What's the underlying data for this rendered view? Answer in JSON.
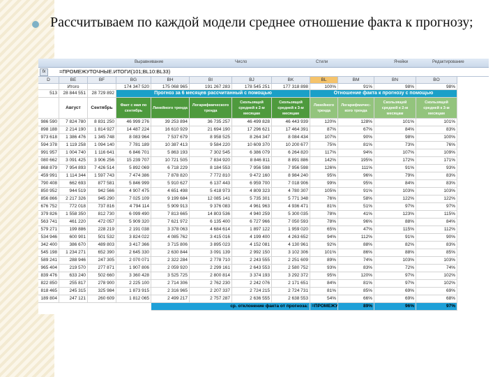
{
  "heading": "Рассчитываем по каждой модели среднее отношение факта к прогнозу;",
  "ribbon": {
    "groups": [
      "Выравнивание",
      "Число",
      "Стили",
      "Ячейки",
      "Редактирование"
    ]
  },
  "formula_bar": {
    "fx_label": "fx",
    "formula": "=ПРОМЕЖУТОЧНЫЕ.ИТОГИ(101;BL10:BL33)"
  },
  "columns": [
    "D",
    "BE",
    "BF",
    "BG",
    "BH",
    "BI",
    "BJ",
    "BK",
    "BL",
    "BM",
    "BN",
    "BO"
  ],
  "selected_column": "BL",
  "totals_row": [
    "",
    "Итого",
    "",
    "174 347 520",
    "175 068 965",
    "191 267 283",
    "178 545 251",
    "177 318 898",
    "100%",
    "91%",
    "98%",
    "98%"
  ],
  "second_row": [
    "513",
    "28 844 551",
    "28 729 892"
  ],
  "band_left": "Прогноз за 6 месяцев рассчитанный с помощью",
  "band_right": "Отношение факта к прогнозу с помощью",
  "headers": [
    "",
    "Август",
    "Сентябрь",
    "Факт с мая по сентябрь",
    "Линейного тренда",
    "Логарифмического тренда",
    "Скользящей средней к 2-м месяцам",
    "Скользящей средней к 3-м месяцам",
    "Линейного тренда",
    "Логарифмичес-кого тренда",
    "Скользящей средней к 2-м месяцам",
    "Скользящей средней к 3-м месяцам"
  ],
  "rows": [
    [
      "986 590",
      "7 824 780",
      "8 831 250",
      "46 999 276",
      "39 253 894",
      "36 735 257",
      "46 499 828",
      "46 443 939",
      "120%",
      "128%",
      "101%",
      "101%"
    ],
    [
      "898 188",
      "2 214 190",
      "1 814 927",
      "14 487 224",
      "16 610 929",
      "21 694 190",
      "17 296 621",
      "17 464 391",
      "87%",
      "67%",
      "84%",
      "83%"
    ],
    [
      "973 618",
      "1 386 476",
      "1 345 748",
      "8 083 964",
      "7 537 679",
      "8 958 525",
      "8 264 347",
      "8 084 434",
      "107%",
      "90%",
      "98%",
      "100%"
    ],
    [
      "594 378",
      "1 119 258",
      "1 094 140",
      "7 781 189",
      "10 387 413",
      "9 584 220",
      "10 609 370",
      "10 200 677",
      "75%",
      "81%",
      "73%",
      "76%"
    ],
    [
      "991 957",
      "1 004 740",
      "1 116 641",
      "6 846 701",
      "5 863 193",
      "7 302 545",
      "6 386 079",
      "6 264 820",
      "117%",
      "94%",
      "107%",
      "109%"
    ],
    [
      "080 662",
      "3 091 425",
      "3 906 256",
      "15 239 707",
      "10 721 505",
      "7 834 920",
      "8 846 811",
      "8 891 886",
      "142%",
      "195%",
      "172%",
      "171%"
    ],
    [
      "868 879",
      "7 954 893",
      "7 426 514",
      "5 892 069",
      "6 718 229",
      "8 184 553",
      "7 956 598",
      "7 956 598",
      "126%",
      "111%",
      "91%",
      "93%"
    ],
    [
      "459 991",
      "1 114 344",
      "1 597 743",
      "7 474 386",
      "7 878 820",
      "7 772 810",
      "9 472 160",
      "8 984 240",
      "95%",
      "96%",
      "79%",
      "83%"
    ],
    [
      "790 408",
      "662 693",
      "877 581",
      "5 846 999",
      "5 910 627",
      "6 137 443",
      "6 959 700",
      "7 018 906",
      "99%",
      "95%",
      "84%",
      "83%"
    ],
    [
      "850 952",
      "944 519",
      "942 566",
      "4 907 475",
      "4 651 498",
      "5 418 973",
      "4 809 323",
      "4 780 307",
      "105%",
      "91%",
      "103%",
      "103%"
    ],
    [
      "856 866",
      "2 217 326",
      "945 290",
      "7 025 109",
      "9 199 684",
      "12 085 141",
      "5 735 301",
      "5 771 348",
      "76%",
      "58%",
      "122%",
      "122%"
    ],
    [
      "676 752",
      "772 018",
      "737 816",
      "4 794 114",
      "5 909 913",
      "9 376 083",
      "4 961 963",
      "4 936 471",
      "81%",
      "51%",
      "97%",
      "97%"
    ],
    [
      "379 826",
      "1 558 350",
      "812 730",
      "6 099 490",
      "7 813 665",
      "14 803 536",
      "4 940 259",
      "5 300 035",
      "78%",
      "41%",
      "123%",
      "115%"
    ],
    [
      "563 741",
      "461 220",
      "472 057",
      "5 909 320",
      "7 621 972",
      "6 135 400",
      "6 727 966",
      "7 050 593",
      "78%",
      "96%",
      "88%",
      "84%"
    ],
    [
      "579 271",
      "199 886",
      "228 219",
      "2 191 038",
      "3 378 063",
      "4 684 614",
      "1 897 122",
      "1 959 020",
      "65%",
      "47%",
      "115%",
      "112%"
    ],
    [
      "534 946",
      "600 901",
      "501 532",
      "3 824 022",
      "4 085 762",
      "3 415 016",
      "4 199 400",
      "4 263 652",
      "94%",
      "112%",
      "91%",
      "90%"
    ],
    [
      "342 400",
      "386 670",
      "489 803",
      "3 417 366",
      "3 715 806",
      "3 895 023",
      "4 152 081",
      "4 130 961",
      "92%",
      "88%",
      "82%",
      "83%"
    ],
    [
      "545 198",
      "1 234 271",
      "652 390",
      "2 645 330",
      "2 630 844",
      "3 091 139",
      "2 992 150",
      "3 102 306",
      "101%",
      "86%",
      "88%",
      "85%"
    ],
    [
      "589 241",
      "288 946",
      "247 305",
      "2 070 071",
      "2 322 284",
      "2 778 710",
      "2 243 555",
      "2 251 609",
      "89%",
      "74%",
      "103%",
      "103%"
    ],
    [
      "965 404",
      "219 570",
      "277 871",
      "1 907 806",
      "2 059 920",
      "2 299 161",
      "2 643 553",
      "2 580 752",
      "93%",
      "83%",
      "72%",
      "74%"
    ],
    [
      "839 476",
      "633 240",
      "502 660",
      "3 360 428",
      "3 525 725",
      "2 800 814",
      "3 374 193",
      "3 292 372",
      "95%",
      "120%",
      "97%",
      "102%"
    ],
    [
      "822 850",
      "255 817",
      "278 900",
      "2 225 100",
      "2 714 306",
      "2 762 230",
      "2 242 076",
      "2 171 651",
      "84%",
      "81%",
      "97%",
      "102%"
    ],
    [
      "818 465",
      "245 315",
      "325 984",
      "1 873 915",
      "2 316 965",
      "2 207 337",
      "2 724 215",
      "2 724 731",
      "81%",
      "85%",
      "69%",
      "69%"
    ],
    [
      "189 804",
      "247 121",
      "260 609",
      "1 812 065",
      "2 499 217",
      "2 757 287",
      "2 636 555",
      "2 638 553",
      "54%",
      "66%",
      "69%",
      "68%"
    ]
  ],
  "bottom_row": {
    "label": "ср. отклонение факта от прогноза:",
    "cell": "=ПРОМЕЖУ",
    "values": [
      "89%",
      "96%",
      "97%"
    ]
  },
  "colors": {
    "green_header": "#4e9a3d",
    "band_blue": "#1aa0c8",
    "selected_column": "#f5c36b"
  }
}
